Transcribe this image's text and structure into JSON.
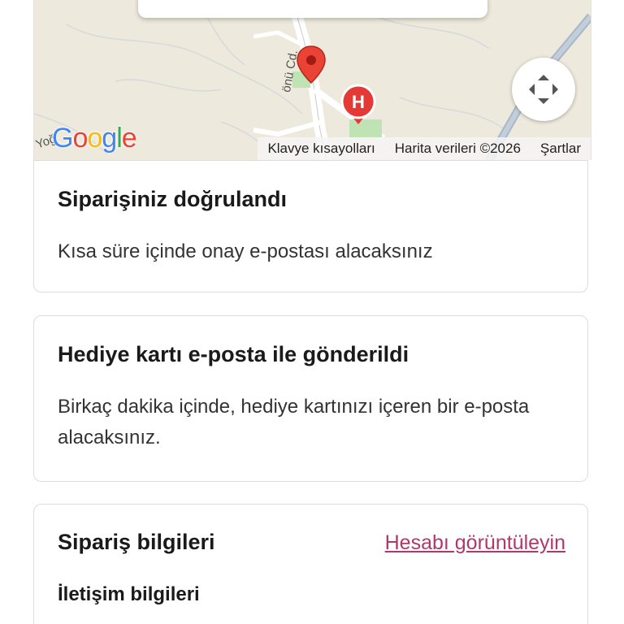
{
  "map": {
    "logo_letters": [
      "G",
      "o",
      "o",
      "g",
      "l",
      "e"
    ],
    "road_label_street": "önü Cd.",
    "road_label_corner": "Yoğ",
    "hospital_letter": "H",
    "footer": {
      "shortcuts": "Klavye kısayolları",
      "map_data": "Harita verileri ©2026",
      "terms": "Şartlar"
    },
    "icons": {
      "pin": "location-pin-icon",
      "hospital": "hospital-icon",
      "fullscreen": "fullscreen-icon"
    },
    "colors": {
      "pin": "#ea4335",
      "hospital": "#e53935",
      "background": "#ede9dc"
    }
  },
  "confirmation_card": {
    "title": "Siparişiniz doğrulandı",
    "text": "Kısa süre içinde onay e-postası alacaksınız"
  },
  "giftcard_card": {
    "title": "Hediye kartı e-posta ile gönderildi",
    "text": "Birkaç dakika içinde, hediye kartınızı içeren bir e-posta alacaksınız."
  },
  "order_info_card": {
    "title": "Sipariş bilgileri",
    "view_account_link": "Hesabı görüntüleyin",
    "contact_title": "İletişim bilgileri"
  },
  "colors": {
    "link": "#b0386e",
    "card_border": "#dcdcdc"
  }
}
